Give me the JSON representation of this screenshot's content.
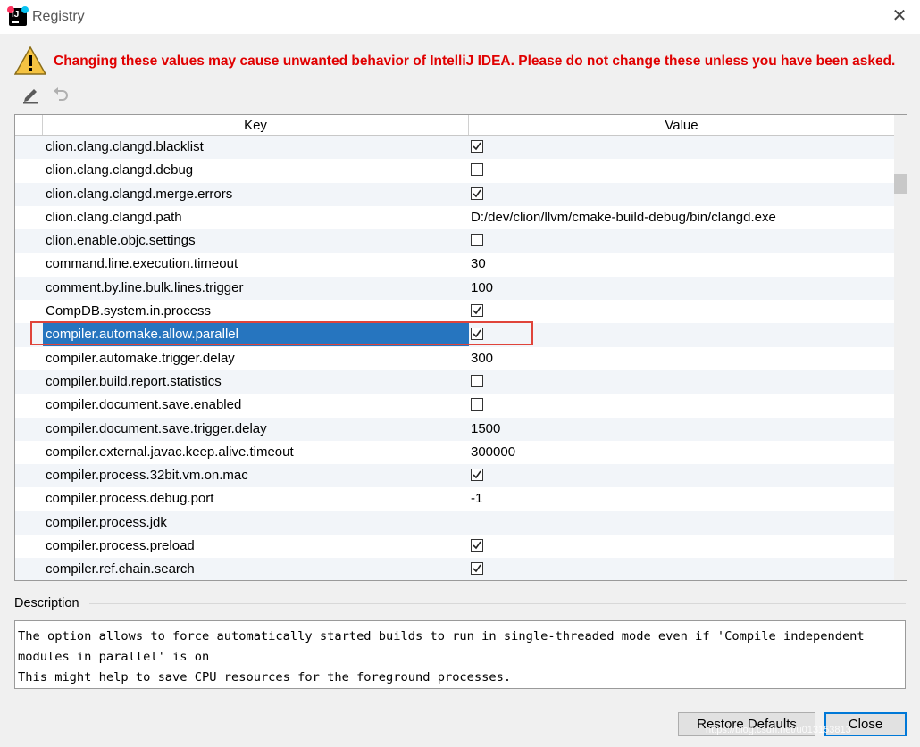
{
  "window": {
    "title": "Registry"
  },
  "warning": {
    "text": "Changing these values may cause unwanted behavior of IntelliJ IDEA. Please do not change these unless you have been asked."
  },
  "table": {
    "headers": {
      "key": "Key",
      "value": "Value"
    },
    "rows": [
      {
        "key": "clion.clang.clangd.blacklist",
        "type": "checkbox",
        "checked": true
      },
      {
        "key": "clion.clang.clangd.debug",
        "type": "checkbox",
        "checked": false
      },
      {
        "key": "clion.clang.clangd.merge.errors",
        "type": "checkbox",
        "checked": true
      },
      {
        "key": "clion.clang.clangd.path",
        "type": "text",
        "value": "D:/dev/clion/llvm/cmake-build-debug/bin/clangd.exe"
      },
      {
        "key": "clion.enable.objc.settings",
        "type": "checkbox",
        "checked": false
      },
      {
        "key": "command.line.execution.timeout",
        "type": "text",
        "value": "30"
      },
      {
        "key": "comment.by.line.bulk.lines.trigger",
        "type": "text",
        "value": "100"
      },
      {
        "key": "CompDB.system.in.process",
        "type": "checkbox",
        "checked": true
      },
      {
        "key": "compiler.automake.allow.parallel",
        "type": "checkbox",
        "checked": true,
        "selected": true
      },
      {
        "key": "compiler.automake.trigger.delay",
        "type": "text",
        "value": "300"
      },
      {
        "key": "compiler.build.report.statistics",
        "type": "checkbox",
        "checked": false
      },
      {
        "key": "compiler.document.save.enabled",
        "type": "checkbox",
        "checked": false
      },
      {
        "key": "compiler.document.save.trigger.delay",
        "type": "text",
        "value": "1500"
      },
      {
        "key": "compiler.external.javac.keep.alive.timeout",
        "type": "text",
        "value": "300000"
      },
      {
        "key": "compiler.process.32bit.vm.on.mac",
        "type": "checkbox",
        "checked": true
      },
      {
        "key": "compiler.process.debug.port",
        "type": "text",
        "value": "-1"
      },
      {
        "key": "compiler.process.jdk",
        "type": "text",
        "value": ""
      },
      {
        "key": "compiler.process.preload",
        "type": "checkbox",
        "checked": true
      },
      {
        "key": "compiler.ref.chain.search",
        "type": "checkbox",
        "checked": true
      }
    ]
  },
  "description": {
    "label": "Description",
    "text": "The option allows to force automatically started builds to run in single-threaded mode even if 'Compile independent modules in parallel' is on\nThis might help to save CPU resources for the foreground processes."
  },
  "buttons": {
    "restore": "Restore Defaults",
    "close": "Close"
  },
  "watermark": "https://blog.csdn.net/u013153813"
}
